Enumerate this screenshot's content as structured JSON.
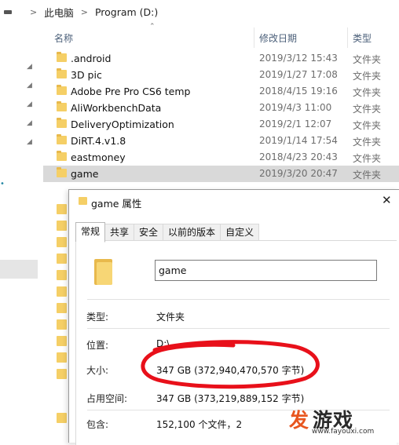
{
  "address": {
    "crumbs": [
      "此电脑",
      "Program (D:)"
    ]
  },
  "columns": {
    "name": "名称",
    "date": "修改日期",
    "type": "类型"
  },
  "files": [
    {
      "name": ".android",
      "date": "2019/3/12 15:43",
      "type": "文件夹"
    },
    {
      "name": "3D pic",
      "date": "2019/1/27 17:08",
      "type": "文件夹"
    },
    {
      "name": "Adobe Pre Pro CS6 temp",
      "date": "2018/4/15 19:16",
      "type": "文件夹"
    },
    {
      "name": "AliWorkbenchData",
      "date": "2019/4/3 11:00",
      "type": "文件夹"
    },
    {
      "name": "DeliveryOptimization",
      "date": "2019/2/1 12:07",
      "type": "文件夹"
    },
    {
      "name": "DiRT.4.v1.8",
      "date": "2019/1/14 17:54",
      "type": "文件夹"
    },
    {
      "name": "eastmoney",
      "date": "2018/4/23 20:43",
      "type": "文件夹"
    },
    {
      "name": "game",
      "date": "2019/3/20 20:47",
      "type": "文件夹"
    }
  ],
  "dialog": {
    "title": "game 属性",
    "tabs": [
      "常规",
      "共享",
      "安全",
      "以前的版本",
      "自定义"
    ],
    "folder_name": "game",
    "props": {
      "type_label": "类型:",
      "type_value": "文件夹",
      "location_label": "位置:",
      "location_value": "D:\\",
      "size_label": "大小:",
      "size_value": "347 GB (372,940,470,570 字节)",
      "disk_label": "占用空间:",
      "disk_value": "347 GB (373,219,889,152 字节)",
      "contains_label": "包含:",
      "contains_value": "152,100 个文件，2"
    }
  },
  "watermark": {
    "logo_a": "发",
    "logo_b": "游戏",
    "url": "www.fayouxi.com"
  },
  "colors": {
    "folder": "#f5cf66",
    "selection": "#d9d9d9",
    "annotation": "#e8101a",
    "watermark_accent": "#e8561f"
  }
}
